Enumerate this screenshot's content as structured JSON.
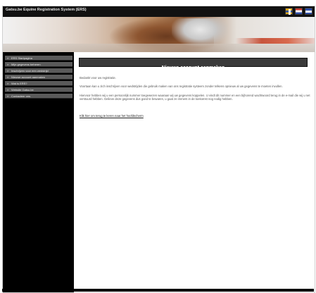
{
  "header": {
    "title": "Gatsu.be Equine Registration System (ERS)",
    "languages": [
      {
        "code": "de",
        "icon": "flag-icon"
      },
      {
        "code": "nl",
        "icon": "flag-icon"
      },
      {
        "code": "en",
        "icon": "flag-icon"
      }
    ]
  },
  "sidebar": {
    "items": [
      {
        "label": "ERS Startpagina"
      },
      {
        "label": "Mijn gegevens beheren"
      },
      {
        "label": "Inschrijven voor een wedstrijd"
      },
      {
        "label": "Nieuwe account aanmaken"
      },
      {
        "label": "Wat is ERS?"
      },
      {
        "label": "Website Gatsu.be"
      },
      {
        "label": "Contacteer ons"
      }
    ]
  },
  "main": {
    "heading": "Nieuwe account aanmaken",
    "paragraphs": [
      "Bedankt voor uw registratie.",
      "Voortaan kan u zich inschrijven voor wedstrijden die gebruik maken van ons registratie systeem zonder telkens opnieuw al uw gegevens te moeten invullen.",
      "Hiervoor hebben wij u een persoonlijk nummer toegewezen waaraan wij uw gegevens koppelen. U vindt dit nummer en een bijhorend wachtwoord terug in de e-mail die wij u net verstuurd hebben. Gelieve deze gegevens dus goed te bewaren, u gaat ze immers in de toekomst nog nodig hebben."
    ],
    "link": "Klik hier om terug te keren naar het hoofdscherm"
  }
}
